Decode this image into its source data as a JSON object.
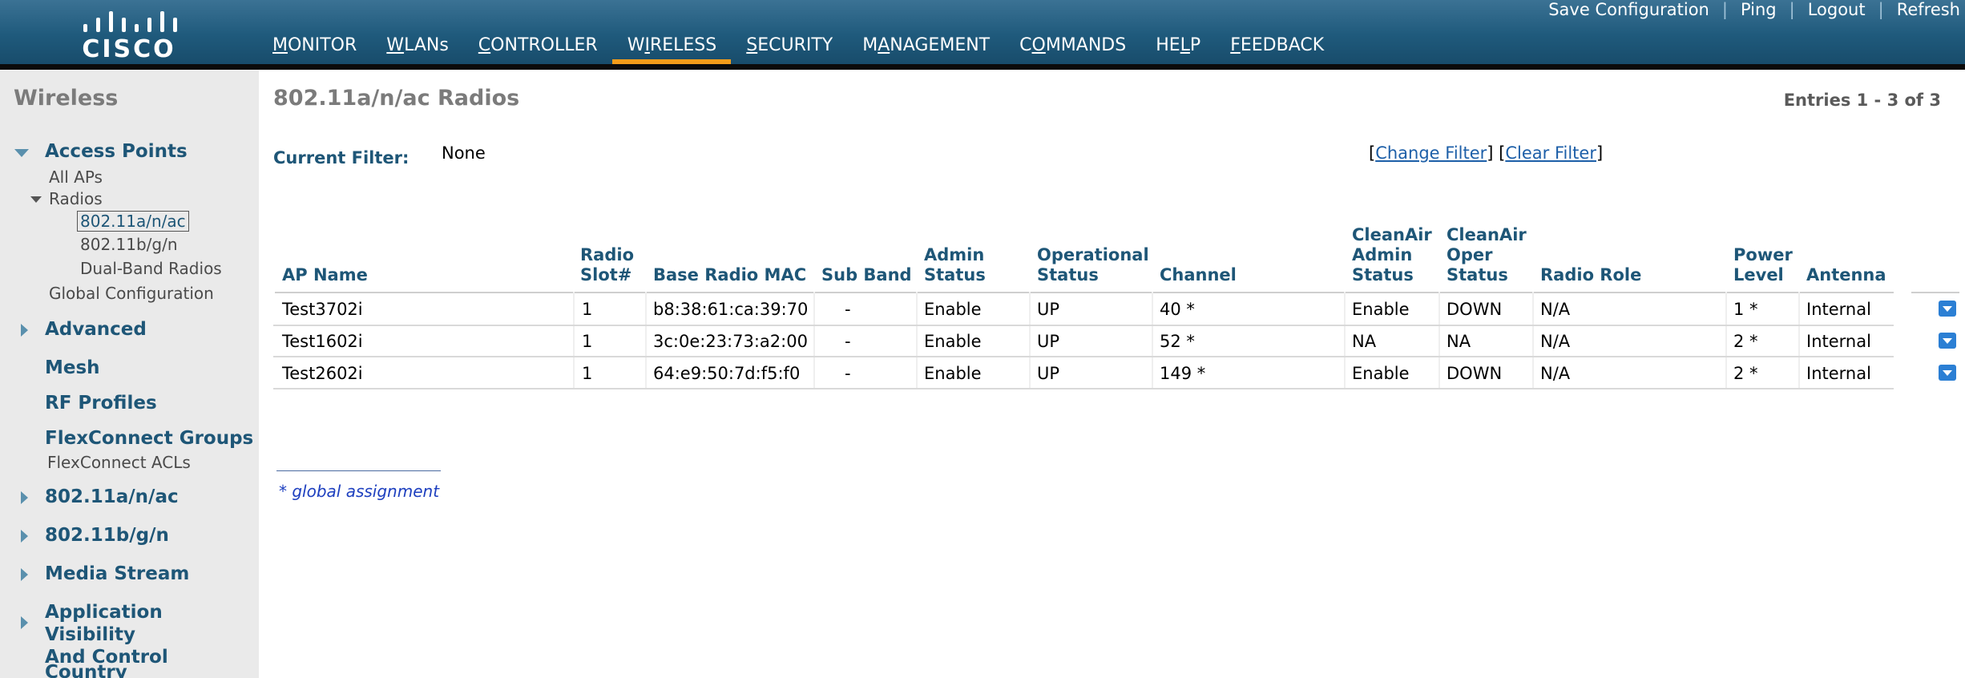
{
  "brand": {
    "logo_text": "CISCO"
  },
  "top_links": [
    "Save Configuration",
    "Ping",
    "Logout",
    "Refresh"
  ],
  "nav": {
    "items": [
      {
        "pre": "",
        "key": "M",
        "post": "ONITOR"
      },
      {
        "pre": "",
        "key": "W",
        "post": "LANs"
      },
      {
        "pre": "",
        "key": "C",
        "post": "ONTROLLER"
      },
      {
        "pre": "W",
        "key": "I",
        "post": "RELESS"
      },
      {
        "pre": "",
        "key": "S",
        "post": "ECURITY"
      },
      {
        "pre": "M",
        "key": "A",
        "post": "NAGEMENT"
      },
      {
        "pre": "C",
        "key": "O",
        "post": "MMANDS"
      },
      {
        "pre": "HE",
        "key": "L",
        "post": "P"
      },
      {
        "pre": "",
        "key": "F",
        "post": "EEDBACK"
      }
    ],
    "active_index": 3,
    "active_color": "#f49d1a"
  },
  "sidebar": {
    "title": "Wireless",
    "access_points": "Access Points",
    "all_aps": "All APs",
    "radios": "Radios",
    "radio_a": "802.11a/n/ac",
    "radio_b": "802.11b/g/n",
    "dual_band": "Dual-Band Radios",
    "global_config": "Global Configuration",
    "advanced": "Advanced",
    "mesh": "Mesh",
    "rf_profiles": "RF Profiles",
    "flexconnect_groups": "FlexConnect Groups",
    "flexconnect_acls": "FlexConnect ACLs",
    "section_a": "802.11a/n/ac",
    "section_b": "802.11b/g/n",
    "media_stream": "Media Stream",
    "app_visibility_1": "Application Visibility",
    "app_visibility_2": "And Control",
    "country": "Country"
  },
  "main": {
    "title": "802.11a/n/ac Radios",
    "entries": "Entries 1 - 3 of 3",
    "filter_label": "Current Filter:",
    "filter_value": "None",
    "change_filter": "Change Filter",
    "clear_filter": "Clear Filter",
    "footnote": "* global assignment"
  },
  "table": {
    "headers": {
      "ap_name": "AP Name",
      "slot_1": "Radio",
      "slot_2": "Slot#",
      "mac": "Base Radio MAC",
      "sub_band": "Sub Band",
      "admin_1": "Admin",
      "admin_2": "Status",
      "oper_1": "Operational",
      "oper_2": "Status",
      "channel": "Channel",
      "ca_admin_1": "CleanAir",
      "ca_admin_2": "Admin",
      "ca_admin_3": "Status",
      "ca_oper_1": "CleanAir",
      "ca_oper_2": "Oper",
      "ca_oper_3": "Status",
      "role": "Radio Role",
      "power_1": "Power",
      "power_2": "Level",
      "antenna": "Antenna"
    },
    "rows": [
      {
        "ap": "Test3702i",
        "slot": "1",
        "mac": "b8:38:61:ca:39:70",
        "sub_band": "-",
        "admin": "Enable",
        "oper": "UP",
        "channel": "40 *",
        "ca_admin": "Enable",
        "ca_oper": "DOWN",
        "role": "N/A",
        "power": "1 *",
        "antenna": "Internal"
      },
      {
        "ap": "Test1602i",
        "slot": "1",
        "mac": "3c:0e:23:73:a2:00",
        "sub_band": "-",
        "admin": "Enable",
        "oper": "UP",
        "channel": "52 *",
        "ca_admin": "NA",
        "ca_oper": "NA",
        "role": "N/A",
        "power": "2 *",
        "antenna": "Internal"
      },
      {
        "ap": "Test2602i",
        "slot": "1",
        "mac": "64:e9:50:7d:f5:f0",
        "sub_band": "-",
        "admin": "Enable",
        "oper": "UP",
        "channel": "149 *",
        "ca_admin": "Enable",
        "ca_oper": "DOWN",
        "role": "N/A",
        "power": "2 *",
        "antenna": "Internal"
      }
    ]
  }
}
